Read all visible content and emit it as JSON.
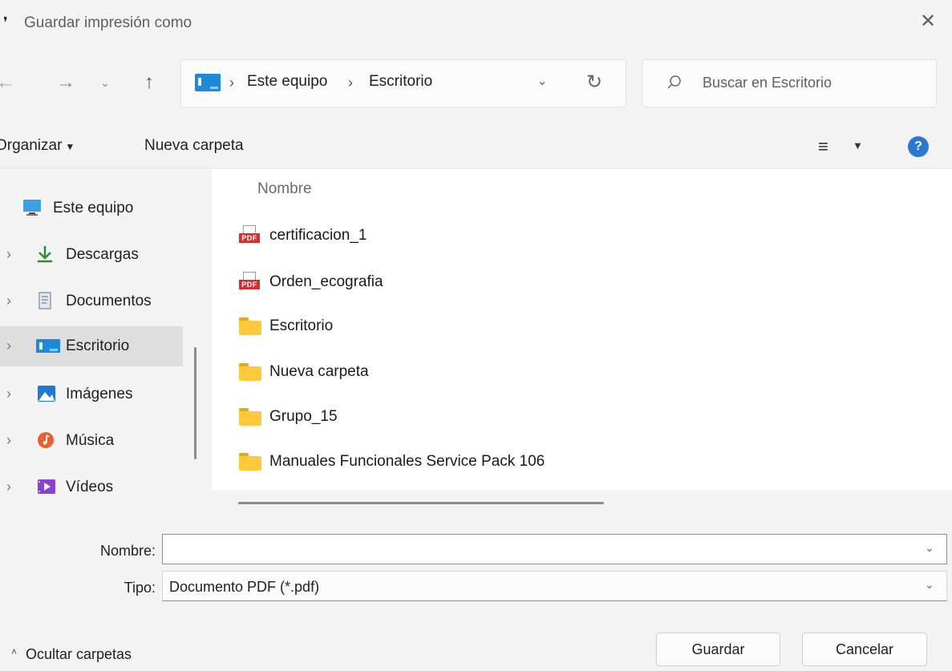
{
  "window": {
    "title": "Guardar impresión como",
    "close_glyph": "✕"
  },
  "nav": {
    "back_glyph": "←",
    "forward_glyph": "→",
    "recent_glyph": "⌄",
    "up_glyph": "↑"
  },
  "address": {
    "icon": "desktop-icon",
    "crumbs": [
      "Este equipo",
      "Escritorio"
    ],
    "separator": "›",
    "dropdown_glyph": "⌄",
    "refresh_glyph": "↻"
  },
  "search": {
    "placeholder": "Buscar en Escritorio"
  },
  "toolbar": {
    "organize_label": "Organizar",
    "new_folder_label": "Nueva carpeta",
    "view_glyph": "≡",
    "caret_glyph": "▼",
    "help_glyph": "?"
  },
  "sidebar": {
    "items": [
      {
        "label": "Este equipo",
        "icon": "computer-icon",
        "expandable": false,
        "selected": false
      },
      {
        "label": "Descargas",
        "icon": "download-icon",
        "expandable": true,
        "selected": false
      },
      {
        "label": "Documentos",
        "icon": "document-icon",
        "expandable": true,
        "selected": false
      },
      {
        "label": "Escritorio",
        "icon": "desktop-icon",
        "expandable": true,
        "selected": true
      },
      {
        "label": "Imágenes",
        "icon": "pictures-icon",
        "expandable": true,
        "selected": false
      },
      {
        "label": "Música",
        "icon": "music-icon",
        "expandable": true,
        "selected": false
      },
      {
        "label": "Vídeos",
        "icon": "videos-icon",
        "expandable": true,
        "selected": false
      }
    ],
    "chevron_glyph": "›"
  },
  "files": {
    "column_header": "Nombre",
    "items": [
      {
        "name": "certificacion_1",
        "type": "pdf"
      },
      {
        "name": "Orden_ecografia",
        "type": "pdf"
      },
      {
        "name": "Escritorio",
        "type": "folder"
      },
      {
        "name": "Nueva carpeta",
        "type": "folder"
      },
      {
        "name": "Grupo_15",
        "type": "folder"
      },
      {
        "name": "Manuales Funcionales Service Pack 106",
        "type": "folder"
      }
    ],
    "pdf_tag": "PDF"
  },
  "form": {
    "name_label": "Nombre:",
    "name_value": "",
    "type_label": "Tipo:",
    "type_value": "Documento PDF (*.pdf)",
    "chevron_glyph": "⌄"
  },
  "footer": {
    "hide_folders_label": "Ocultar carpetas",
    "hide_caret": "˄",
    "save_label": "Guardar",
    "cancel_label": "Cancelar"
  },
  "colors": {
    "accent": "#2b78d4",
    "selected_bg": "#dedede",
    "folder": "#ffc83d",
    "pdf": "#d32f2f"
  }
}
